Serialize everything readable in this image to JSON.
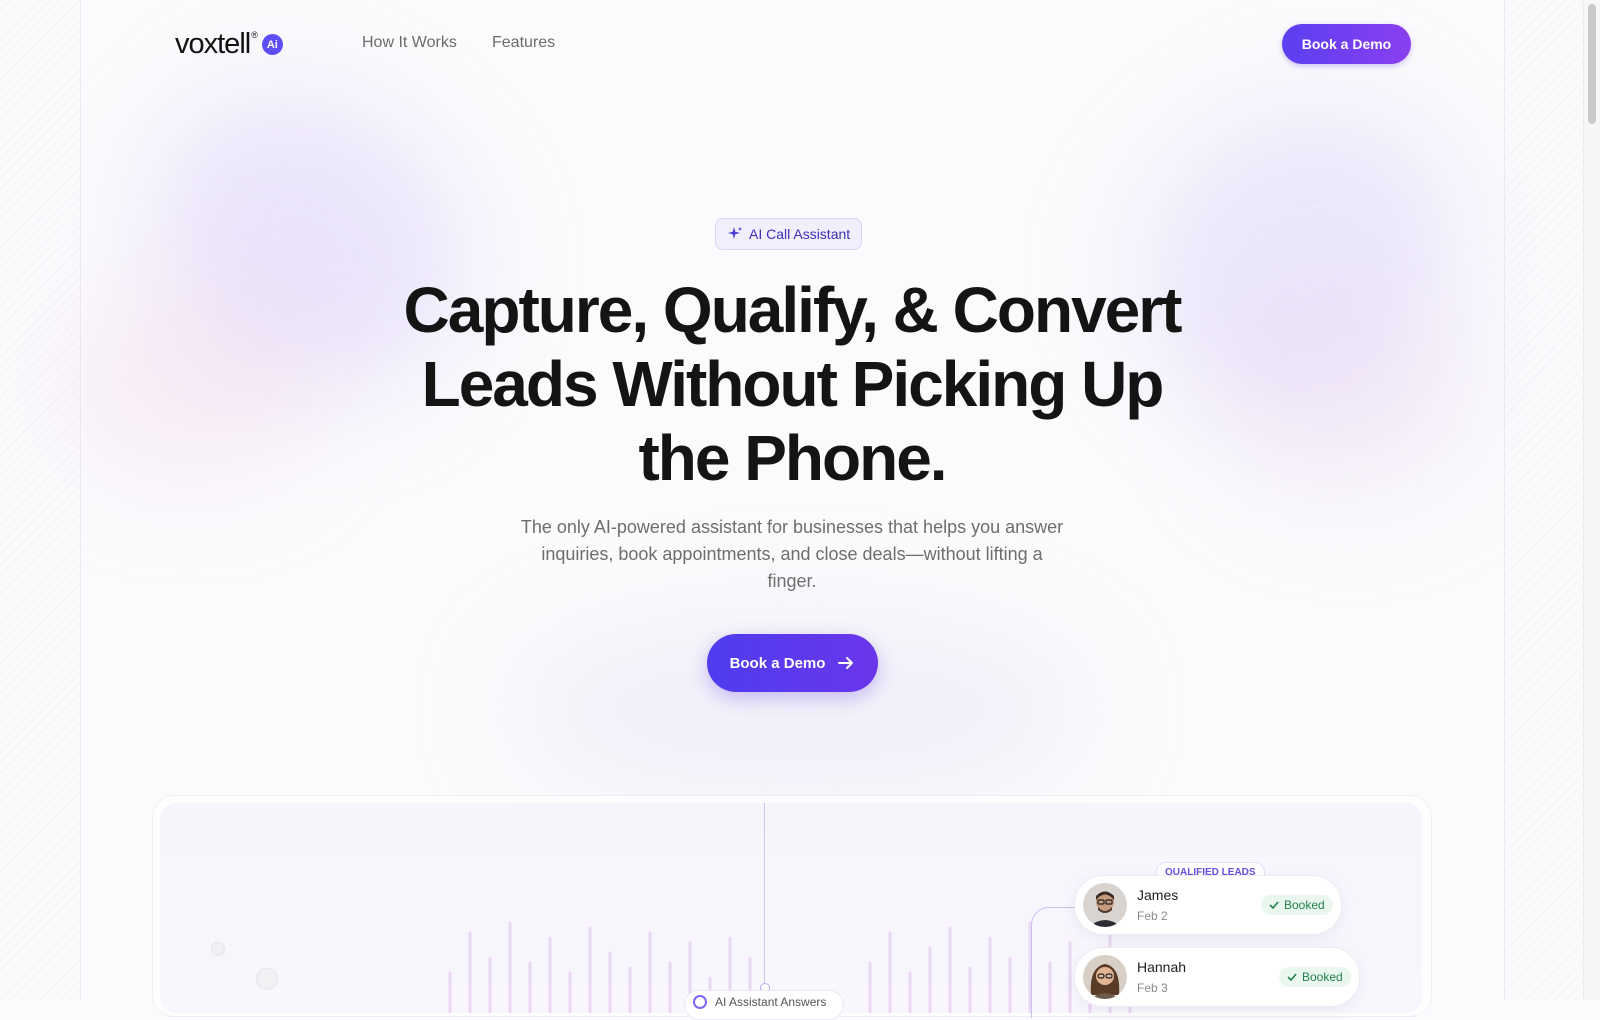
{
  "brand": {
    "name": "voxtell",
    "registered": "®",
    "badge": "Ai"
  },
  "nav": {
    "links": [
      "How It Works",
      "Features"
    ],
    "cta": "Book a Demo"
  },
  "hero": {
    "badge": "AI Call Assistant",
    "headline": "Capture, Qualify, & Convert Leads Without Picking Up the Phone.",
    "subhead": "The only AI-powered assistant for businesses that helps you answer inquiries, book appointments, and close deals—without lifting a finger.",
    "cta": "Book a Demo"
  },
  "preview": {
    "assistant_label": "AI Assistant Answers",
    "qualified_tag": "QUALIFIED LEADS",
    "leads": [
      {
        "name": "James",
        "date": "Feb 2",
        "status": "Booked"
      },
      {
        "name": "Hannah",
        "date": "Feb 3",
        "status": "Booked"
      }
    ]
  },
  "colors": {
    "accent": "#5b3ff0",
    "accent2": "#8a3ff0",
    "success": "#23804b"
  }
}
